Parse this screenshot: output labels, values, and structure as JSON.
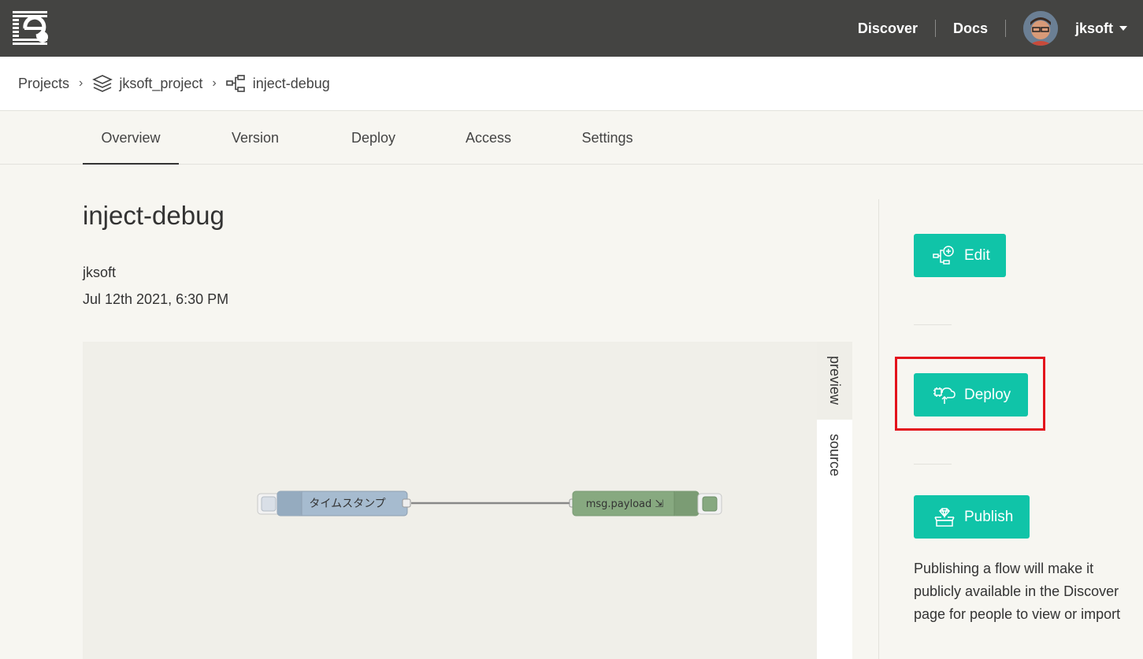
{
  "nav": {
    "links": [
      "Discover",
      "Docs"
    ],
    "user": "jksoft"
  },
  "breadcrumb": {
    "projects": "Projects",
    "project": "jksoft_project",
    "flow": "inject-debug"
  },
  "tabs": [
    "Overview",
    "Version",
    "Deploy",
    "Access",
    "Settings"
  ],
  "active_tab": "Overview",
  "flow": {
    "title": "inject-debug",
    "author": "jksoft",
    "date": "Jul 12th 2021, 6:30 PM"
  },
  "side_tabs": [
    "preview",
    "source"
  ],
  "nodes": {
    "inject_label": "タイムスタンプ",
    "debug_label": "msg.payload ⇲"
  },
  "actions": {
    "edit": "Edit",
    "deploy": "Deploy",
    "publish": "Publish",
    "publish_note": "Publishing a flow will make it publicly available in the Discover page for people to view or import"
  },
  "colors": {
    "accent": "#10c4a8",
    "topbar": "#444442",
    "highlight": "#e3131c"
  }
}
